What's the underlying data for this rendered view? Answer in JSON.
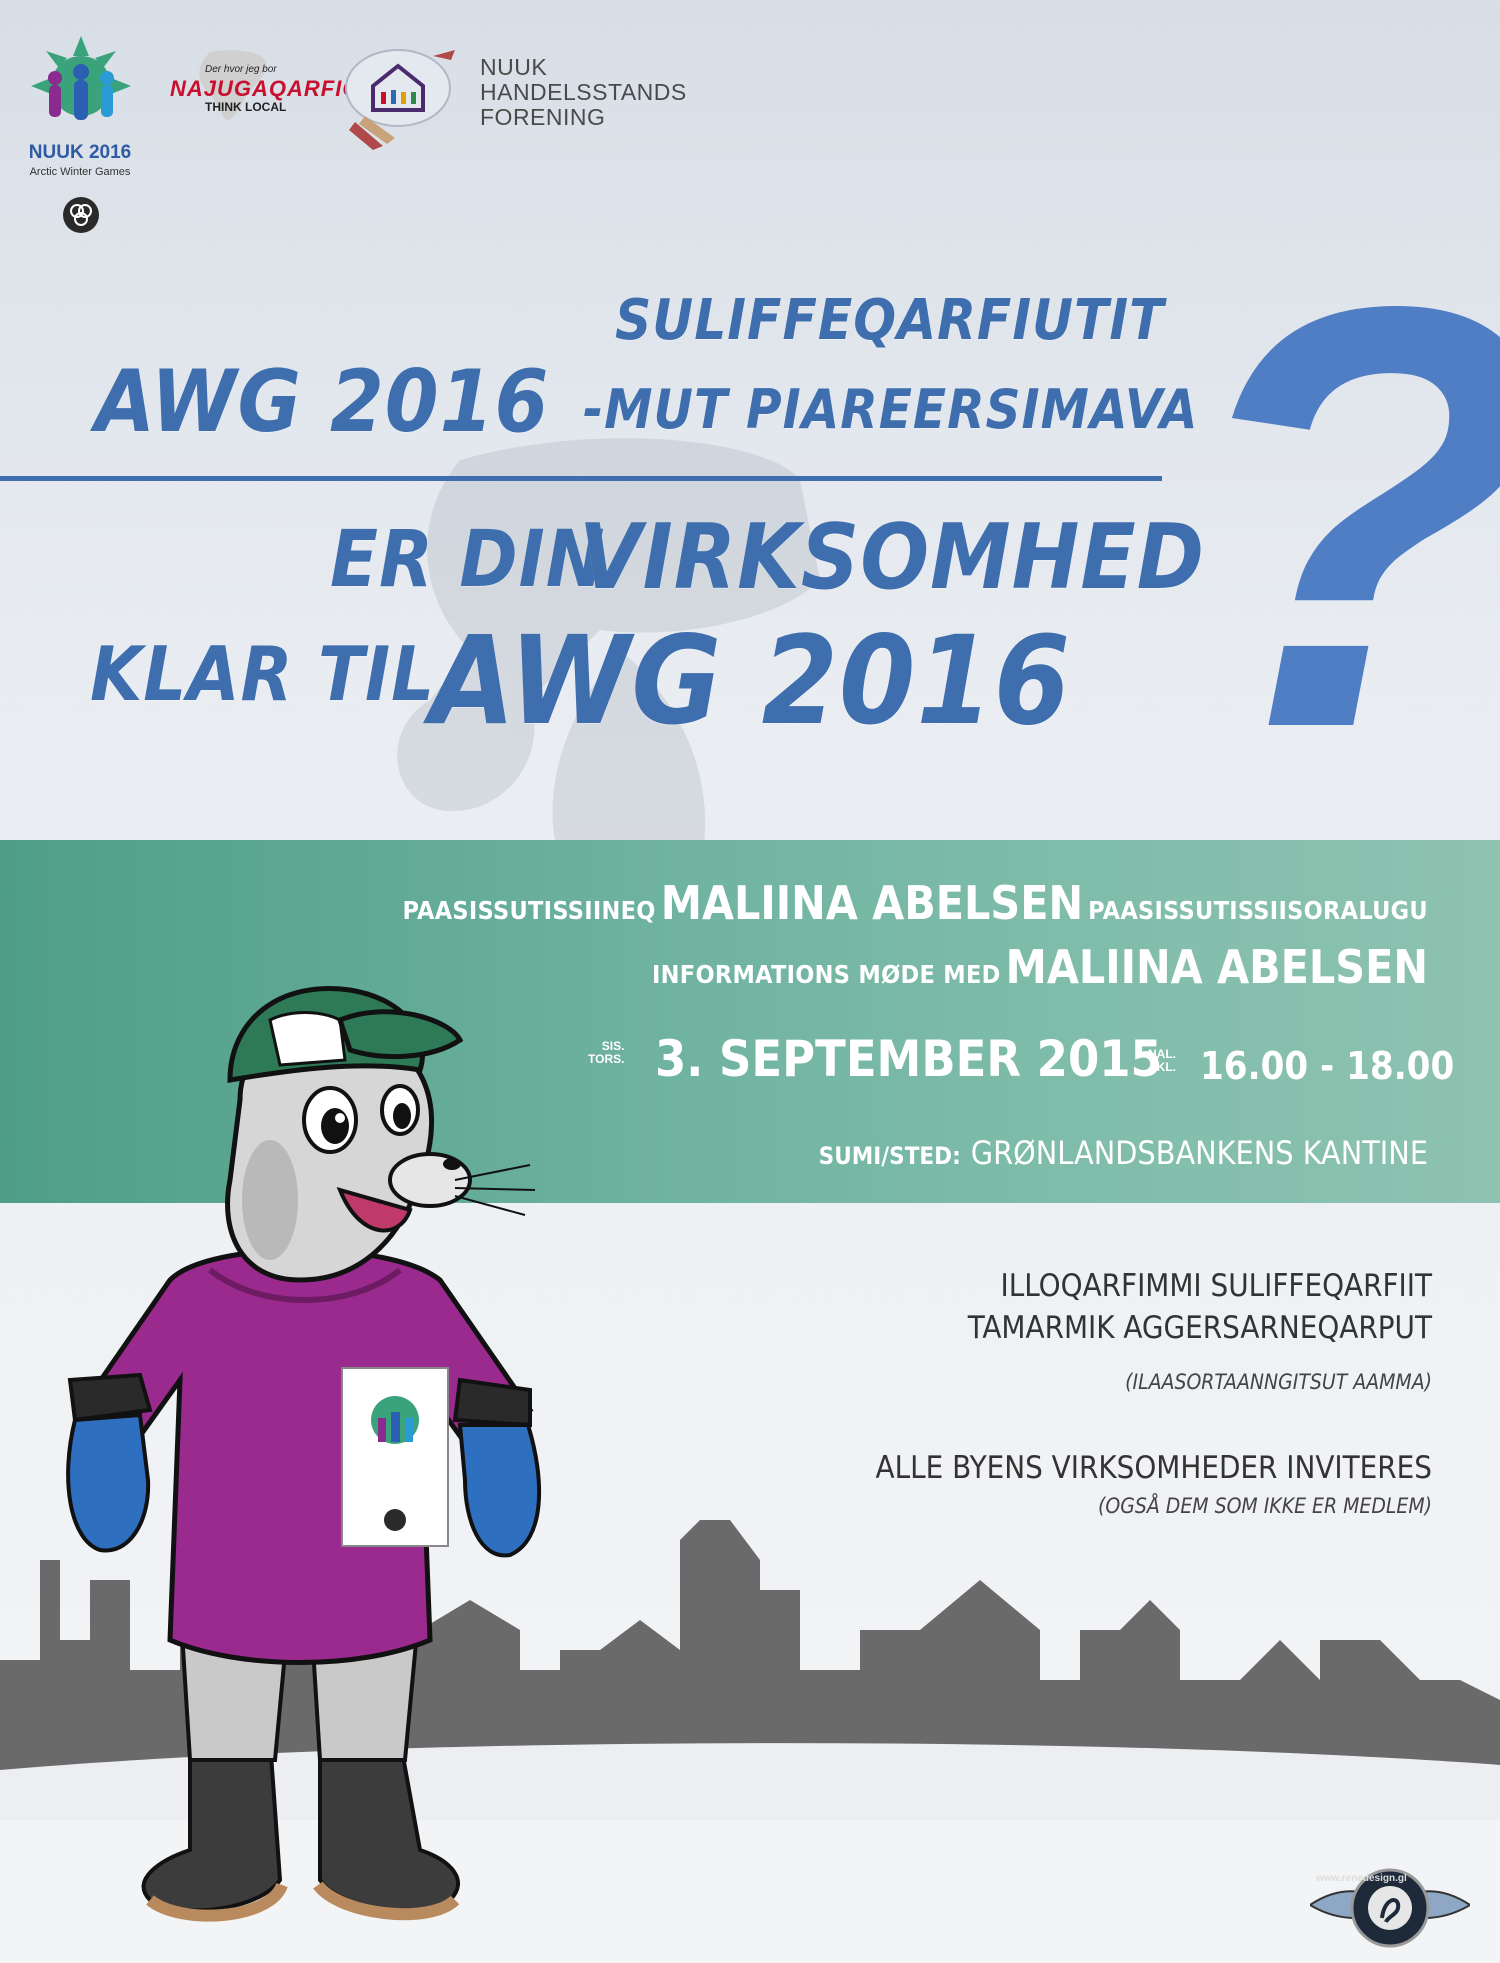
{
  "logos": {
    "nuuk": {
      "title": "NUUK 2016",
      "subtitle": "Arctic Winter Games"
    },
    "najugaqarfiga": {
      "tagline": "Der hvor jeg bor",
      "name": "NAJUGAQARFIGA",
      "sub": "THINK LOCAL"
    },
    "nhf": {
      "line1": "NUUK",
      "line2": "HANDELSSTANDS",
      "line3": "FORENING"
    }
  },
  "headline": {
    "kl_line1": "SULIFFEQARFIUTIT",
    "kl_line2_big": "AWG 2016",
    "kl_line2_small": "-MUT PIAREERSIMAVA",
    "da_line1_small": "ER DIN",
    "da_line1_big": "VIRKSOMHED",
    "da_line2_small": "KLAR TIL",
    "da_line2_big": "AWG 2016",
    "question_mark": "?"
  },
  "meeting": {
    "kl_prefix": "PAASISSUTISSIINEQ",
    "name": "MALIINA ABELSEN",
    "kl_suffix": "PAASISSUTISSIISORALUGU",
    "da_prefix": "INFORMATIONS MØDE MED",
    "date_label_kl": "SIS.",
    "date_label_da": "TORS.",
    "date": "3. SEPTEMBER 2015",
    "time_label_kl": "NAL.",
    "time_label_da": "KL.",
    "time": "16.00 - 18.00",
    "place_label": "SUMI/STED:",
    "place": "GRØNLANDSBANKENS KANTINE"
  },
  "invitation": {
    "kl_line1": "ILLOQARFIMMI SULIFFEQARFIIT",
    "kl_line2": "TAMARMIK AGGERSARNEQARPUT",
    "kl_note": "(ILAASORTAANNGITSUT AAMMA)",
    "da_line": "ALLE BYENS VIRKSOMHEDER INVITERES",
    "da_note": "(OGSÅ DEM SOM IKKE ER MEDLEM)"
  },
  "mascot_badge": {
    "title": "NUUK 2016",
    "subtitle": "Arctic Winter Games"
  },
  "credit": {
    "url": "www.renedesign.gl",
    "name": "Rene Design"
  },
  "colors": {
    "headline_blue": "#3e6ead",
    "band_green": "#6fb3a0",
    "hoodie_purple": "#9b2a8e",
    "cap_green": "#2e7a57",
    "mitten_blue": "#2f6fc0"
  }
}
